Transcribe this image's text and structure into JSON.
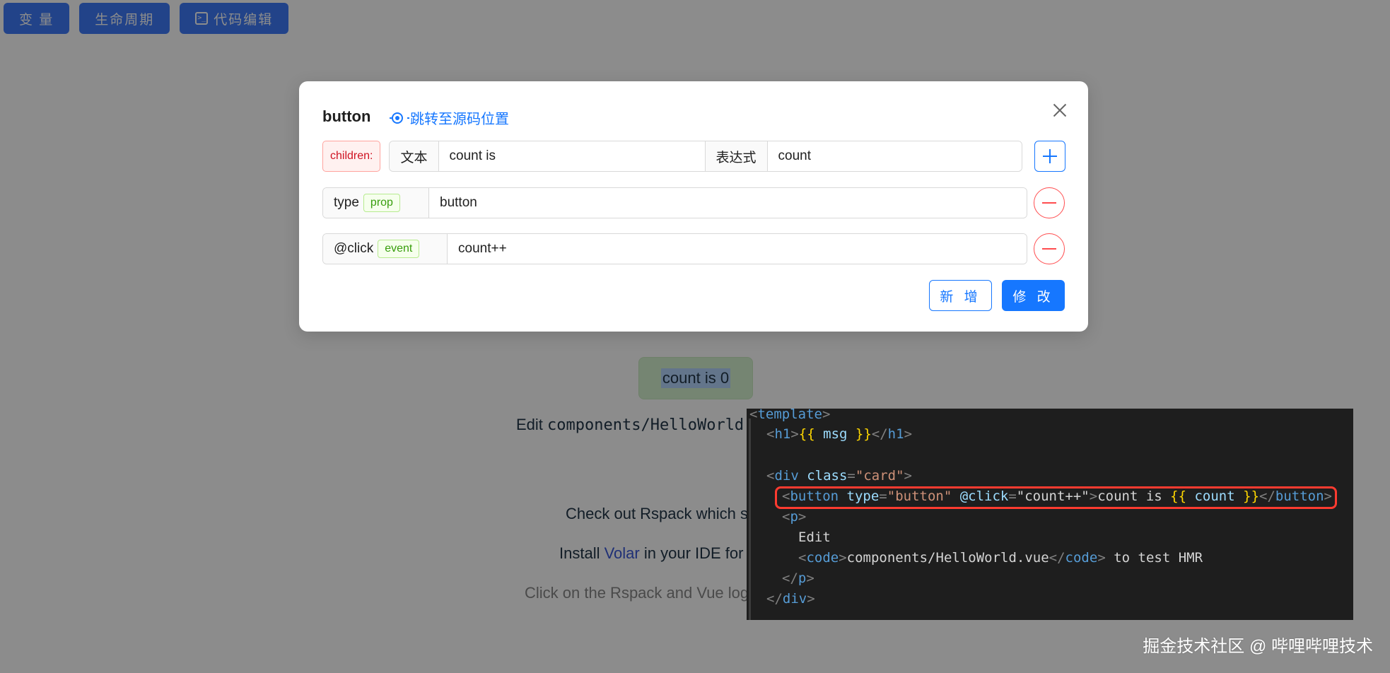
{
  "toolbar": {
    "btn_variables": "变 量",
    "btn_lifecycle": "生命周期",
    "btn_code_edit": "代码编辑",
    "code_icon": "terminal-icon"
  },
  "background": {
    "counter_button": "count is 0",
    "edit_prefix": "Edit ",
    "edit_code": "components/HelloWorld",
    "line_rspack": "Check out Rspack which s",
    "line_volar_prefix": "Install ",
    "line_volar_link": "Volar",
    "line_volar_suffix": " in your IDE for",
    "line_logos": "Click on the Rspack and Vue log"
  },
  "modal": {
    "title": "button",
    "jump_link": "跳转至源码位置",
    "children_label": "children:",
    "text_addon": "文本",
    "text_value": "count is",
    "expr_addon": "表达式",
    "expr_value": "count",
    "prop_name": "type",
    "prop_tag": "prop",
    "prop_value": "button",
    "event_name": "@click",
    "event_tag": "event",
    "event_value": "count++",
    "btn_add": "新 增",
    "btn_modify": "修 改"
  },
  "code": {
    "l1_open": "<",
    "l1_tag": "template",
    "l1_close": ">",
    "l2_open": "<",
    "l2_tag": "h1",
    "l2_close": ">",
    "l2_mopen": "{{",
    "l2_expr": " msg ",
    "l2_mclose": "}}",
    "l2_end_open": "</",
    "l2_end_tag": "h1",
    "l2_end_close": ">",
    "l4_open": "<",
    "l4_tag": "div",
    "l4_attr": " class",
    "l4_eq": "=",
    "l4_val": "\"card\"",
    "l4_close": ">",
    "l5_open": "<",
    "l5_tag": "button",
    "l5_attr1": " type",
    "l5_eq1": "=",
    "l5_val1": "\"button\"",
    "l5_attr2": " @click",
    "l5_eq2": "=",
    "l5_val2": "\"count++\"",
    "l5_close": ">",
    "l5_text": "count is ",
    "l5_mopen": "{{",
    "l5_expr": " count ",
    "l5_mclose": "}}",
    "l5_end_open": "</",
    "l5_end_tag": "button",
    "l5_end_close": ">",
    "l6_open": "<",
    "l6_tag": "p",
    "l6_close": ">",
    "l7_text": "Edit",
    "l8_open": "<",
    "l8_tag": "code",
    "l8_close": ">",
    "l8_text": "components/HelloWorld.vue",
    "l8_end_open": "</",
    "l8_end_tag": "code",
    "l8_end_close": ">",
    "l8_suffix": " to test HMR",
    "l9_open": "</",
    "l9_tag": "p",
    "l9_close": ">",
    "l10_open": "</",
    "l10_tag": "div",
    "l10_close": ">"
  },
  "watermark": "掘金技术社区 @ 哔哩哔哩技术",
  "colors": {
    "primary": "#1677ff",
    "danger": "#ff4d4f",
    "highlight_box": "#ff3b30",
    "code_bg": "#1e1e1e"
  }
}
